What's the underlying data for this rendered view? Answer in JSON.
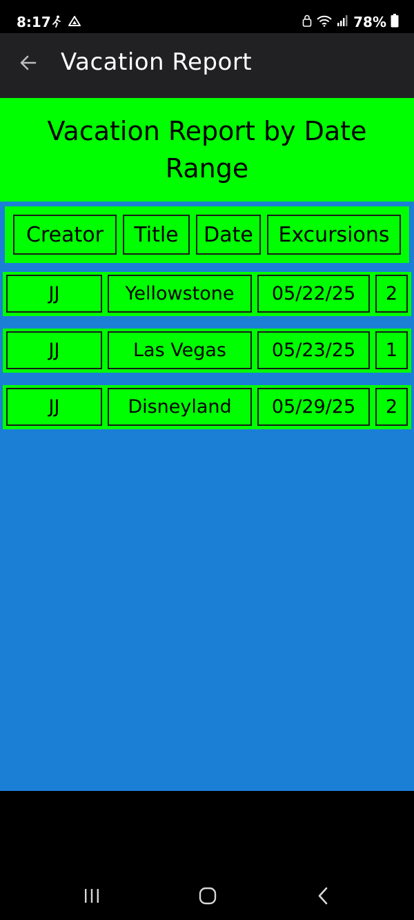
{
  "status_bar": {
    "time": "8:17",
    "battery": "78%"
  },
  "app_bar": {
    "title": "Vacation Report"
  },
  "report": {
    "heading": "Vacation Report by Date Range",
    "columns": [
      "Creator",
      "Title",
      "Date",
      "Excursions"
    ],
    "rows": [
      {
        "creator": "JJ",
        "title": "Yellowstone",
        "date": "05/22/25",
        "excursions": "2"
      },
      {
        "creator": "JJ",
        "title": "Las Vegas",
        "date": "05/23/25",
        "excursions": "1"
      },
      {
        "creator": "JJ",
        "title": "Disneyland",
        "date": "05/29/25",
        "excursions": "2"
      }
    ]
  },
  "colors": {
    "accent_green": "#00ff00",
    "background_blue": "#1b7fd6",
    "app_bar": "#212124"
  },
  "icons": {
    "back": "arrow-back-icon",
    "nav_recents": "recents-icon",
    "nav_home": "home-icon",
    "nav_back": "chevron-left-icon"
  }
}
